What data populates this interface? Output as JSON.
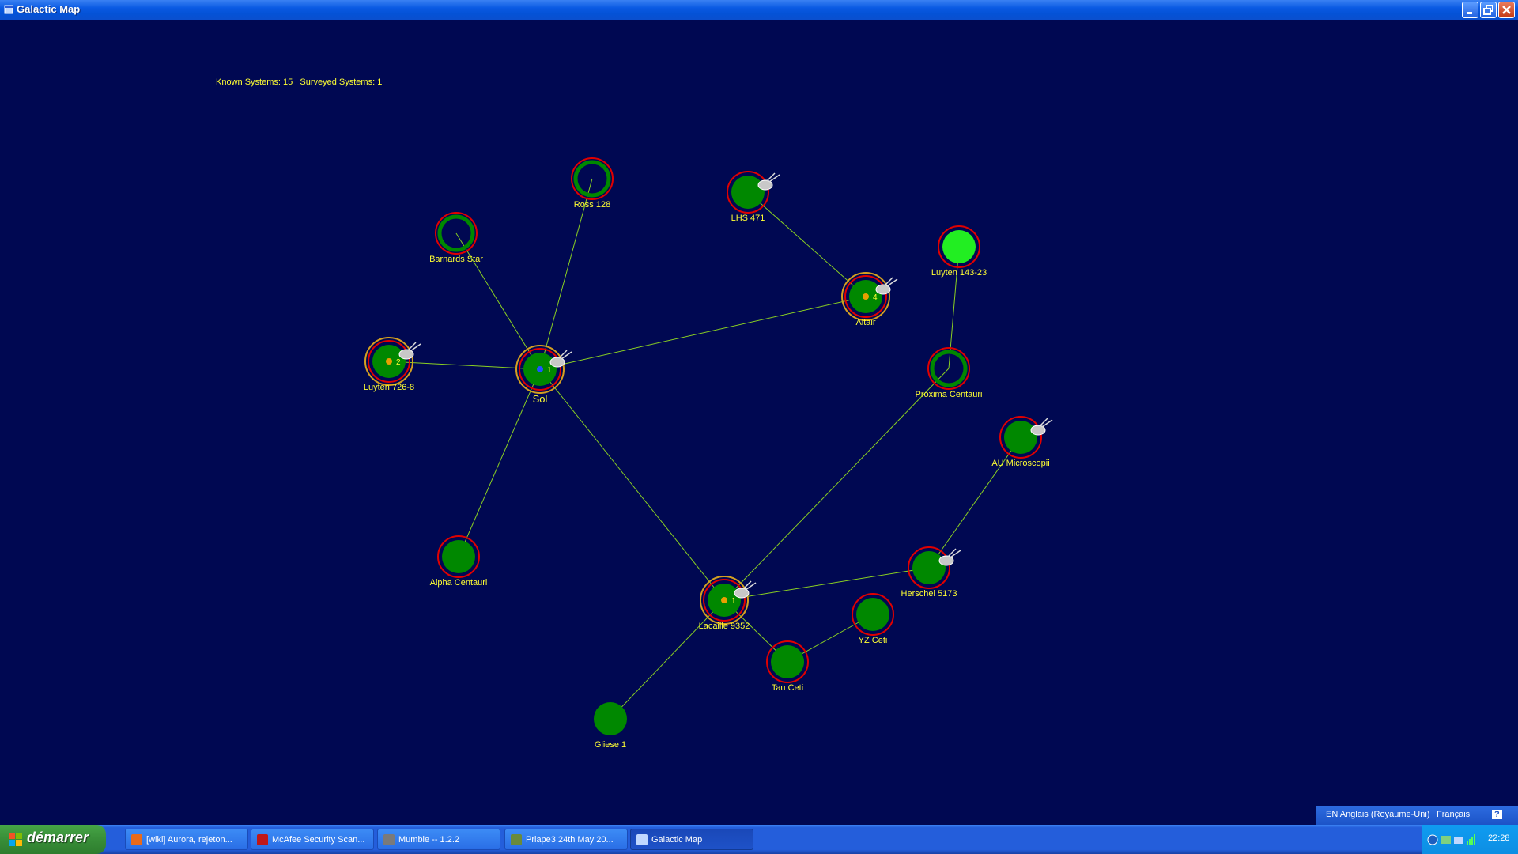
{
  "window": {
    "title": "Galactic Map",
    "buttons": [
      "minimize",
      "restore",
      "close"
    ]
  },
  "stats": {
    "text": "Known Systems: 15   Surveyed Systems: 1"
  },
  "colors": {
    "background": "#000852",
    "planet": "#008800",
    "bright_planet": "#22ee22",
    "ring": "#e00000",
    "outer_ring": "#d4a020",
    "link": "#8ad022",
    "label": "#ffff33",
    "fleet_dot": "#e8a000",
    "home_dot": "#2050ff"
  },
  "map": {
    "systems": [
      {
        "id": "sol",
        "name": "Sol",
        "filled": true,
        "fleet": true,
        "home": true,
        "count": "1"
      },
      {
        "id": "ross128",
        "name": "Ross 128",
        "filled": false,
        "fleet": false
      },
      {
        "id": "barnards",
        "name": "Barnards Star",
        "filled": false,
        "fleet": false
      },
      {
        "id": "lhs471",
        "name": "LHS 471",
        "filled": true,
        "fleet": false,
        "ship": true
      },
      {
        "id": "altair",
        "name": "Altair",
        "filled": true,
        "fleet": true,
        "count": "4",
        "ship": true
      },
      {
        "id": "luyten143",
        "name": "Luyten 143-23",
        "filled": true,
        "bright": true,
        "fleet": false
      },
      {
        "id": "proxima",
        "name": "Proxima Centauri",
        "filled": false,
        "fleet": false
      },
      {
        "id": "luyten726",
        "name": "Luyten 726-8",
        "filled": true,
        "fleet": true,
        "count": "2",
        "ship": true
      },
      {
        "id": "auMic",
        "name": "AU Microscopii",
        "filled": true,
        "fleet": false,
        "ship": true
      },
      {
        "id": "alphaCen",
        "name": "Alpha Centauri",
        "filled": true,
        "fleet": false
      },
      {
        "id": "lacaille",
        "name": "Lacaille 9352",
        "filled": true,
        "fleet": true,
        "count": "1",
        "ship": true
      },
      {
        "id": "herschel",
        "name": "Herschel 5173",
        "filled": true,
        "fleet": false,
        "ship": true
      },
      {
        "id": "yzceti",
        "name": "YZ Ceti",
        "filled": true,
        "fleet": false
      },
      {
        "id": "tauceti",
        "name": "Tau Ceti",
        "filled": true,
        "fleet": false
      },
      {
        "id": "gliese1",
        "name": "Gliese 1",
        "filled": true,
        "fleet": false,
        "noring": true
      }
    ],
    "links": [
      [
        "sol",
        "ross128"
      ],
      [
        "sol",
        "barnards"
      ],
      [
        "sol",
        "altair"
      ],
      [
        "sol",
        "luyten726"
      ],
      [
        "sol",
        "alphaCen"
      ],
      [
        "sol",
        "lacaille"
      ],
      [
        "lhs471",
        "altair"
      ],
      [
        "luyten143",
        "proxima"
      ],
      [
        "proxima",
        "lacaille"
      ],
      [
        "lacaille",
        "herschel"
      ],
      [
        "herschel",
        "auMic"
      ],
      [
        "lacaille",
        "tauceti"
      ],
      [
        "tauceti",
        "yzceti"
      ],
      [
        "lacaille",
        "gliese1"
      ]
    ]
  },
  "language_bar": {
    "language": "EN Anglais (Royaume-Uni)",
    "keyboard": "Français",
    "help": "?"
  },
  "taskbar": {
    "start_label": "démarrer",
    "tasks": [
      {
        "label": "[wiki] Aurora, rejeton...",
        "icon_color": "#e86a1a"
      },
      {
        "label": "McAfee Security Scan...",
        "icon_color": "#c01818"
      },
      {
        "label": "Mumble -- 1.2.2",
        "icon_color": "#7a7a7a"
      },
      {
        "label": "Priape3  24th May 20...",
        "icon_color": "#6a8a3a"
      },
      {
        "label": "Galactic Map",
        "icon_color": "#c0d8ff",
        "active": true
      }
    ],
    "clock": "22:28"
  }
}
